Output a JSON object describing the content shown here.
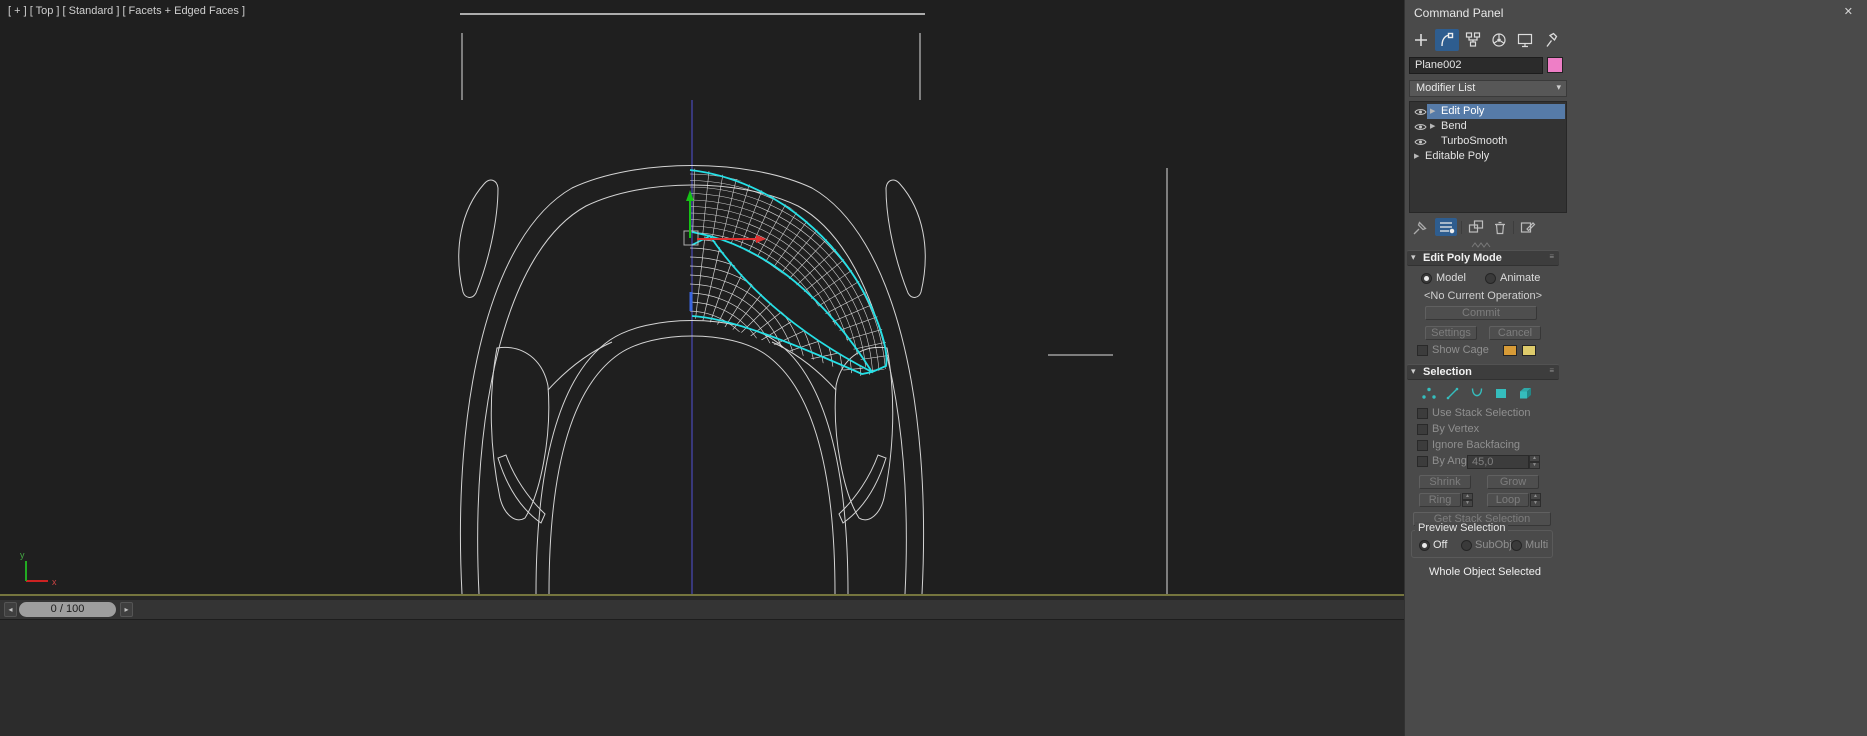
{
  "viewport": {
    "label": "[ + ] [ Top ] [ Standard ] [ Facets + Edged Faces ]",
    "axis_x": "x",
    "axis_y": "y"
  },
  "timeline": {
    "frame": "0 / 100"
  },
  "icons": {
    "close": "✕",
    "combo_arrow": "▾",
    "rollout_arrow": "▾",
    "grip": "≡",
    "spinner_up": "▲",
    "spinner_down": "▼",
    "prev": "◂",
    "next": "▸",
    "expand_arrow": "▶"
  },
  "colors": {
    "accent": "#2e5d8f",
    "stack_selection": "#567ba8",
    "selected_edge": "#25e0e6",
    "object_color": "#ee7ec6",
    "cage_color_1": "#d79b37",
    "cage_color_2": "#decb6b"
  },
  "command_panel": {
    "title": "Command Panel",
    "tabs": [
      "create",
      "modify",
      "hierarchy",
      "motion",
      "display",
      "utilities"
    ],
    "active_tab": "modify",
    "object_name": "Plane002",
    "modifier_list_label": "Modifier List",
    "stack": [
      {
        "label": "Edit Poly",
        "selected": true
      },
      {
        "label": "Bend",
        "selected": false
      },
      {
        "label": "TurboSmooth",
        "selected": false
      },
      {
        "label": "Editable Poly",
        "selected": false
      }
    ],
    "stack_tools": [
      "pin-stack",
      "show-end-result",
      "make-unique",
      "remove-modifier",
      "configure-modifier-sets"
    ],
    "edit_poly_mode": {
      "title": "Edit Poly Mode",
      "model_label": "Model",
      "animate_label": "Animate",
      "operation": "<No Current Operation>",
      "commit_label": "Commit",
      "settings_label": "Settings",
      "cancel_label": "Cancel",
      "show_cage_label": "Show Cage"
    },
    "selection": {
      "title": "Selection",
      "use_stack_selection_label": "Use Stack Selection",
      "by_vertex_label": "By Vertex",
      "ignore_backfacing_label": "Ignore Backfacing",
      "by_angle_label": "By Angle:",
      "by_angle_value": "45,0",
      "shrink_label": "Shrink",
      "grow_label": "Grow",
      "ring_label": "Ring",
      "loop_label": "Loop",
      "get_stack_label": "Get Stack Selection",
      "preview_title": "Preview Selection",
      "preview_off": "Off",
      "preview_subobj": "SubObj",
      "preview_multi": "Multi",
      "status": "Whole Object Selected"
    }
  }
}
